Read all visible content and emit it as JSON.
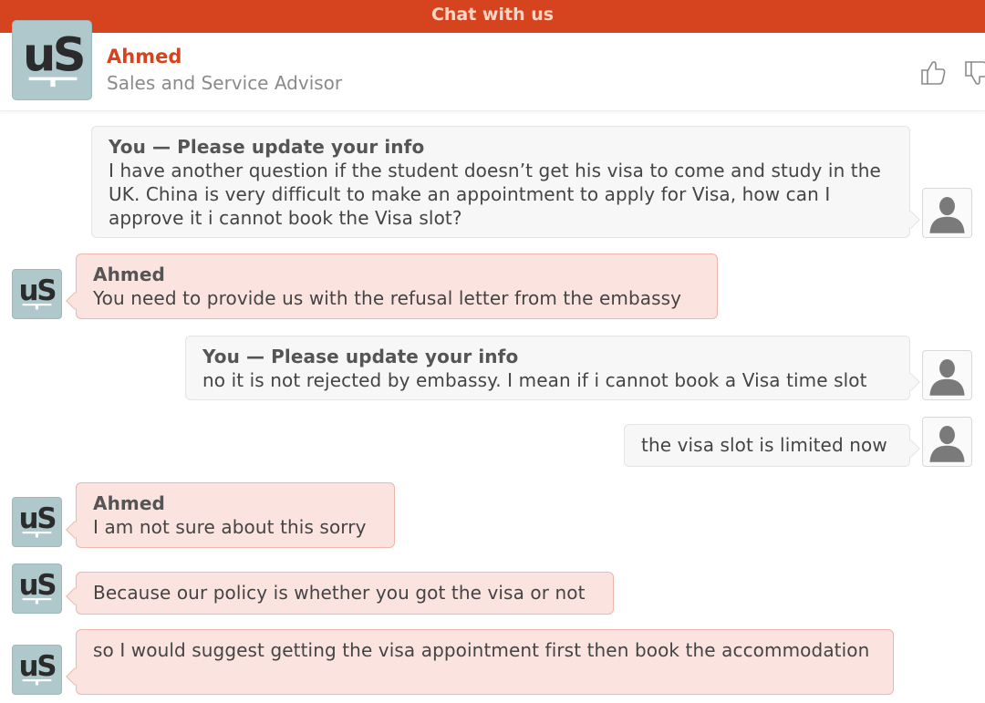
{
  "window": {
    "title": "Chat with us"
  },
  "agent": {
    "name": "Ahmed",
    "role": "Sales and Service Advisor",
    "logo_text": "uS"
  },
  "rating": {
    "up_icon": "thumbs-up-icon",
    "down_icon": "thumbs-down-icon"
  },
  "messages": [
    {
      "from": "user",
      "sender": "You — Please update your info",
      "text": "I have another question if the student doesn’t get his visa to come and study in the UK. China is very difficult to make an appointment to apply for Visa, how can I approve it i cannot book the Visa slot?"
    },
    {
      "from": "agent",
      "sender": "Ahmed",
      "text": "You need to provide us with the refusal letter from the embassy"
    },
    {
      "from": "user",
      "sender": "You — Please update your info",
      "text": "no it is not rejected by embassy. I mean if i cannot book a Visa time slot"
    },
    {
      "from": "user",
      "sender": "",
      "text": "the visa slot is limited now"
    },
    {
      "from": "agent",
      "sender": "Ahmed",
      "text": "I am not sure about this sorry"
    },
    {
      "from": "agent",
      "sender": "",
      "text": "Because our policy is whether you got the visa or not"
    },
    {
      "from": "agent",
      "sender": "",
      "text": "so I would suggest getting the visa appointment first then book the accommodation"
    }
  ],
  "colors": {
    "brand": "#d5441f",
    "agent_bubble": "#fbe4e0",
    "user_bubble": "#f7f7f7",
    "logo_bg": "#aec8cc"
  }
}
